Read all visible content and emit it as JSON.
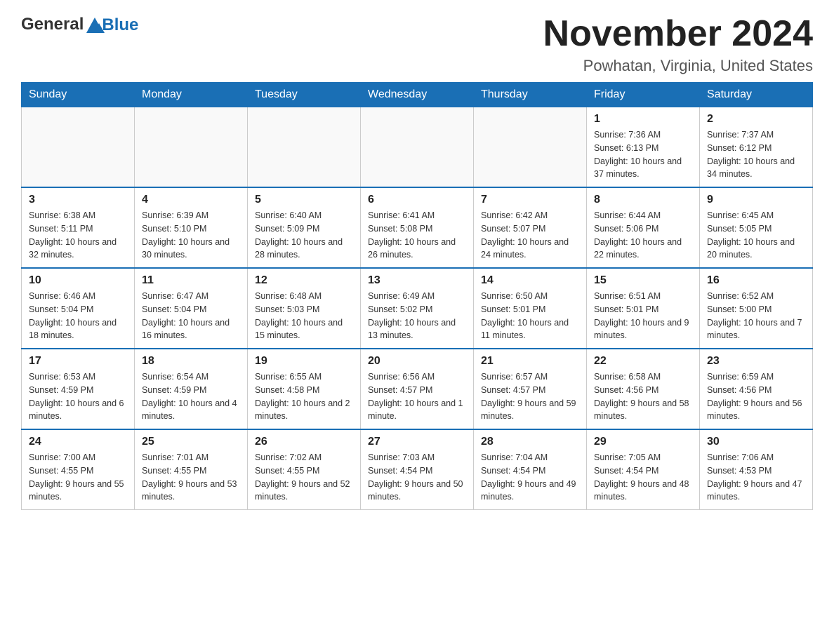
{
  "logo": {
    "general": "General",
    "blue": "Blue"
  },
  "header": {
    "month": "November 2024",
    "location": "Powhatan, Virginia, United States"
  },
  "days_of_week": [
    "Sunday",
    "Monday",
    "Tuesday",
    "Wednesday",
    "Thursday",
    "Friday",
    "Saturday"
  ],
  "weeks": [
    [
      {
        "day": "",
        "info": ""
      },
      {
        "day": "",
        "info": ""
      },
      {
        "day": "",
        "info": ""
      },
      {
        "day": "",
        "info": ""
      },
      {
        "day": "",
        "info": ""
      },
      {
        "day": "1",
        "info": "Sunrise: 7:36 AM\nSunset: 6:13 PM\nDaylight: 10 hours and 37 minutes."
      },
      {
        "day": "2",
        "info": "Sunrise: 7:37 AM\nSunset: 6:12 PM\nDaylight: 10 hours and 34 minutes."
      }
    ],
    [
      {
        "day": "3",
        "info": "Sunrise: 6:38 AM\nSunset: 5:11 PM\nDaylight: 10 hours and 32 minutes."
      },
      {
        "day": "4",
        "info": "Sunrise: 6:39 AM\nSunset: 5:10 PM\nDaylight: 10 hours and 30 minutes."
      },
      {
        "day": "5",
        "info": "Sunrise: 6:40 AM\nSunset: 5:09 PM\nDaylight: 10 hours and 28 minutes."
      },
      {
        "day": "6",
        "info": "Sunrise: 6:41 AM\nSunset: 5:08 PM\nDaylight: 10 hours and 26 minutes."
      },
      {
        "day": "7",
        "info": "Sunrise: 6:42 AM\nSunset: 5:07 PM\nDaylight: 10 hours and 24 minutes."
      },
      {
        "day": "8",
        "info": "Sunrise: 6:44 AM\nSunset: 5:06 PM\nDaylight: 10 hours and 22 minutes."
      },
      {
        "day": "9",
        "info": "Sunrise: 6:45 AM\nSunset: 5:05 PM\nDaylight: 10 hours and 20 minutes."
      }
    ],
    [
      {
        "day": "10",
        "info": "Sunrise: 6:46 AM\nSunset: 5:04 PM\nDaylight: 10 hours and 18 minutes."
      },
      {
        "day": "11",
        "info": "Sunrise: 6:47 AM\nSunset: 5:04 PM\nDaylight: 10 hours and 16 minutes."
      },
      {
        "day": "12",
        "info": "Sunrise: 6:48 AM\nSunset: 5:03 PM\nDaylight: 10 hours and 15 minutes."
      },
      {
        "day": "13",
        "info": "Sunrise: 6:49 AM\nSunset: 5:02 PM\nDaylight: 10 hours and 13 minutes."
      },
      {
        "day": "14",
        "info": "Sunrise: 6:50 AM\nSunset: 5:01 PM\nDaylight: 10 hours and 11 minutes."
      },
      {
        "day": "15",
        "info": "Sunrise: 6:51 AM\nSunset: 5:01 PM\nDaylight: 10 hours and 9 minutes."
      },
      {
        "day": "16",
        "info": "Sunrise: 6:52 AM\nSunset: 5:00 PM\nDaylight: 10 hours and 7 minutes."
      }
    ],
    [
      {
        "day": "17",
        "info": "Sunrise: 6:53 AM\nSunset: 4:59 PM\nDaylight: 10 hours and 6 minutes."
      },
      {
        "day": "18",
        "info": "Sunrise: 6:54 AM\nSunset: 4:59 PM\nDaylight: 10 hours and 4 minutes."
      },
      {
        "day": "19",
        "info": "Sunrise: 6:55 AM\nSunset: 4:58 PM\nDaylight: 10 hours and 2 minutes."
      },
      {
        "day": "20",
        "info": "Sunrise: 6:56 AM\nSunset: 4:57 PM\nDaylight: 10 hours and 1 minute."
      },
      {
        "day": "21",
        "info": "Sunrise: 6:57 AM\nSunset: 4:57 PM\nDaylight: 9 hours and 59 minutes."
      },
      {
        "day": "22",
        "info": "Sunrise: 6:58 AM\nSunset: 4:56 PM\nDaylight: 9 hours and 58 minutes."
      },
      {
        "day": "23",
        "info": "Sunrise: 6:59 AM\nSunset: 4:56 PM\nDaylight: 9 hours and 56 minutes."
      }
    ],
    [
      {
        "day": "24",
        "info": "Sunrise: 7:00 AM\nSunset: 4:55 PM\nDaylight: 9 hours and 55 minutes."
      },
      {
        "day": "25",
        "info": "Sunrise: 7:01 AM\nSunset: 4:55 PM\nDaylight: 9 hours and 53 minutes."
      },
      {
        "day": "26",
        "info": "Sunrise: 7:02 AM\nSunset: 4:55 PM\nDaylight: 9 hours and 52 minutes."
      },
      {
        "day": "27",
        "info": "Sunrise: 7:03 AM\nSunset: 4:54 PM\nDaylight: 9 hours and 50 minutes."
      },
      {
        "day": "28",
        "info": "Sunrise: 7:04 AM\nSunset: 4:54 PM\nDaylight: 9 hours and 49 minutes."
      },
      {
        "day": "29",
        "info": "Sunrise: 7:05 AM\nSunset: 4:54 PM\nDaylight: 9 hours and 48 minutes."
      },
      {
        "day": "30",
        "info": "Sunrise: 7:06 AM\nSunset: 4:53 PM\nDaylight: 9 hours and 47 minutes."
      }
    ]
  ]
}
